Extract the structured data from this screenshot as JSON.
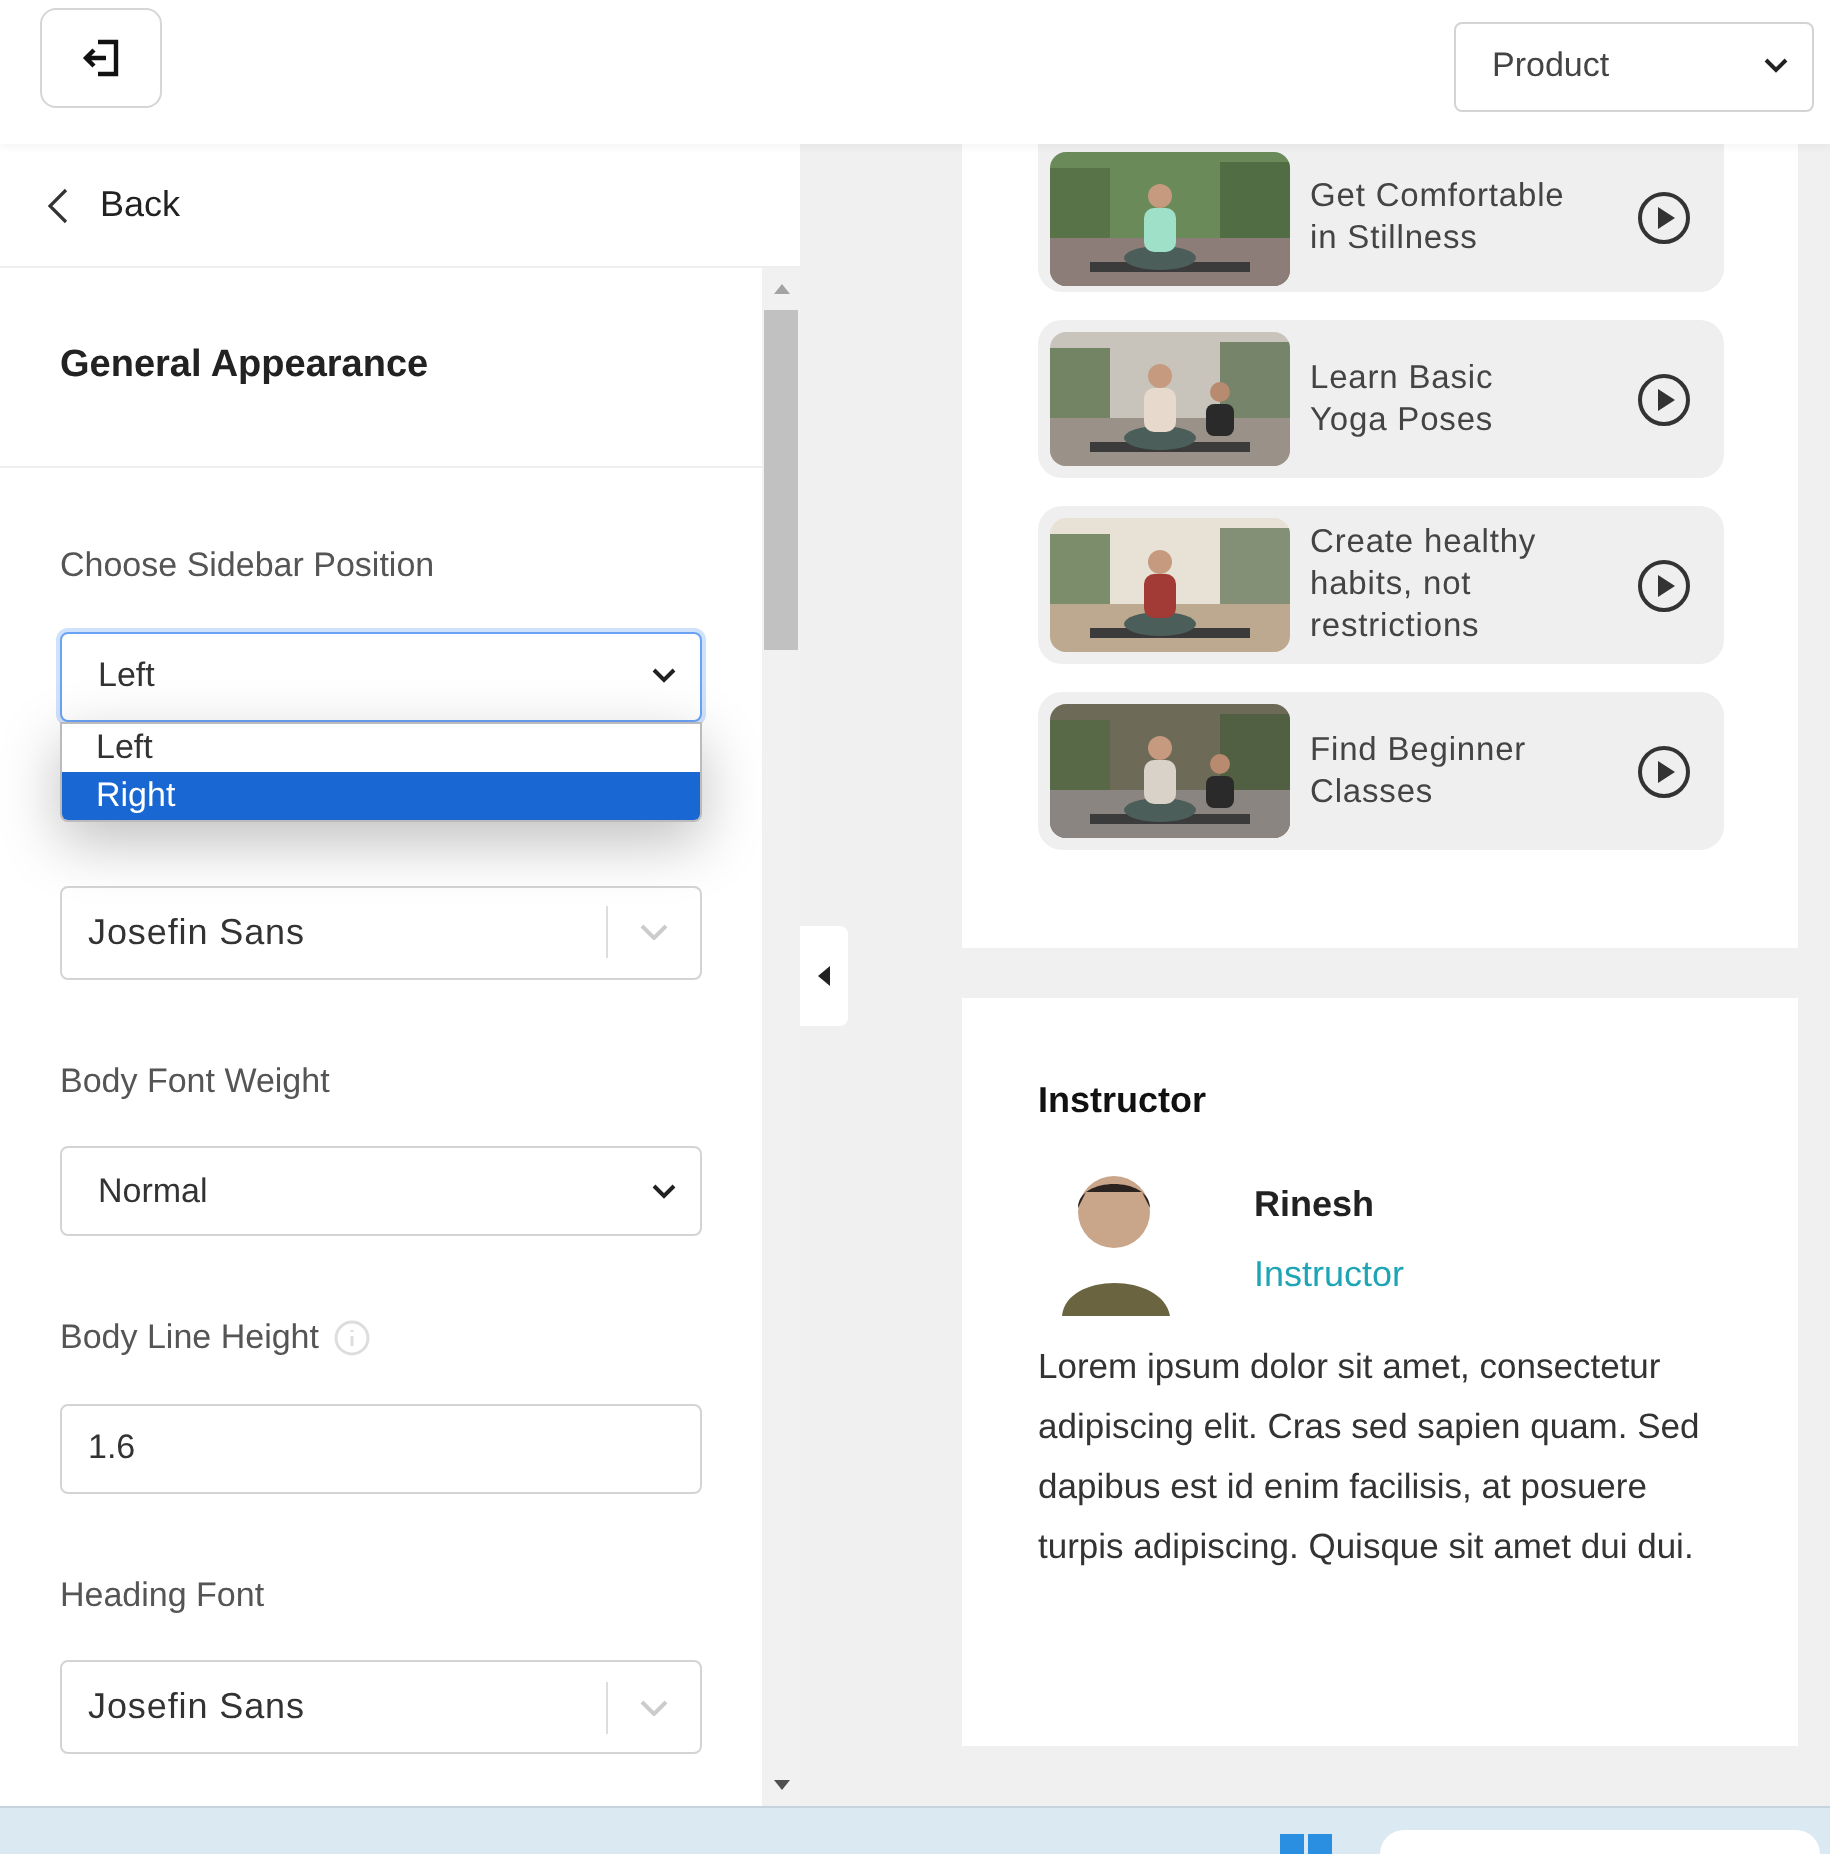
{
  "toolbar": {
    "page_select": "Product"
  },
  "sidebar": {
    "back": "Back",
    "section_title": "General Appearance",
    "fields": [
      {
        "kind": "select",
        "label": "Choose Sidebar Position",
        "value": "Left",
        "focused": true,
        "options": [
          {
            "label": "Left",
            "highlighted": false
          },
          {
            "label": "Right",
            "highlighted": true
          }
        ]
      },
      {
        "kind": "combo",
        "value": "Josefin Sans"
      },
      {
        "kind": "select",
        "label": "Body Font Weight",
        "value": "Normal",
        "focused": false
      },
      {
        "kind": "input",
        "label": "Body Line Height",
        "info": true,
        "value": "1.6"
      },
      {
        "kind": "combo",
        "label": "Heading Font",
        "value": "Josefin Sans"
      }
    ]
  },
  "lessons": [
    {
      "title": "Get Comfortable in Stillness"
    },
    {
      "title": "Learn Basic Yoga Poses"
    },
    {
      "title": "Create healthy habits, not restrictions"
    },
    {
      "title": "Find Beginner Classes"
    }
  ],
  "instructor": {
    "heading": "Instructor",
    "name": "Rinesh",
    "role": "Instructor",
    "bio": "Lorem ipsum dolor sit amet, consectetur adipiscing elit. Cras sed sapien quam. Sed dapibus est id enim facilisis, at posuere turpis adipiscing. Quisque sit amet dui dui."
  }
}
